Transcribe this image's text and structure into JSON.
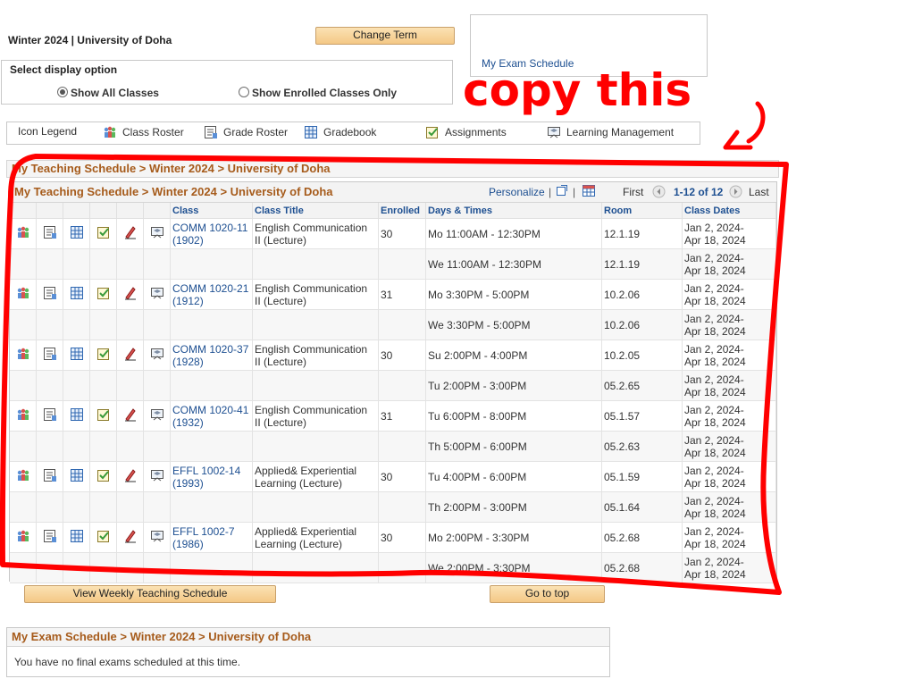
{
  "term_label": "Winter 2024 | University of Doha",
  "change_term_label": "Change Term",
  "exam_schedule_link": "My Exam Schedule",
  "display_option": {
    "title": "Select display option",
    "show_all": "Show All Classes",
    "show_enrolled": "Show Enrolled Classes Only",
    "selected": "show_all"
  },
  "legend": {
    "title": "Icon Legend",
    "items": [
      "Class Roster",
      "Grade Roster",
      "Gradebook",
      "Assignments",
      "Learning Management"
    ]
  },
  "outer_header": "My Teaching Schedule > Winter 2024 > University of Doha",
  "grid": {
    "title": "My Teaching Schedule > Winter 2024 > University of Doha",
    "personalize": "Personalize",
    "separator": "|",
    "first": "First",
    "range": "1-12 of 12",
    "last": "Last",
    "columns": [
      "Class",
      "Class Title",
      "Enrolled",
      "Days & Times",
      "Room",
      "Class Dates"
    ],
    "rows": [
      {
        "icons": true,
        "class_code": "COMM 1020-11",
        "class_num": "(1902)",
        "title1": "English Communication",
        "title2": "II (Lecture)",
        "enrolled": "30",
        "days": "Mo 11:00AM - 12:30PM",
        "room": "12.1.19",
        "date1": "Jan 2, 2024-",
        "date2": "Apr 18, 2024"
      },
      {
        "icons": false,
        "class_code": "",
        "class_num": "",
        "title1": "",
        "title2": "",
        "enrolled": "",
        "days": "We 11:00AM - 12:30PM",
        "room": "12.1.19",
        "date1": "Jan 2, 2024-",
        "date2": "Apr 18, 2024"
      },
      {
        "icons": true,
        "class_code": "COMM 1020-21",
        "class_num": "(1912)",
        "title1": "English Communication",
        "title2": "II (Lecture)",
        "enrolled": "31",
        "days": "Mo 3:30PM - 5:00PM",
        "room": "10.2.06",
        "date1": "Jan 2, 2024-",
        "date2": "Apr 18, 2024"
      },
      {
        "icons": false,
        "class_code": "",
        "class_num": "",
        "title1": "",
        "title2": "",
        "enrolled": "",
        "days": "We 3:30PM - 5:00PM",
        "room": "10.2.06",
        "date1": "Jan 2, 2024-",
        "date2": "Apr 18, 2024"
      },
      {
        "icons": true,
        "class_code": "COMM 1020-37",
        "class_num": "(1928)",
        "title1": "English Communication",
        "title2": "II (Lecture)",
        "enrolled": "30",
        "days": "Su 2:00PM - 4:00PM",
        "room": "10.2.05",
        "date1": "Jan 2, 2024-",
        "date2": "Apr 18, 2024"
      },
      {
        "icons": false,
        "class_code": "",
        "class_num": "",
        "title1": "",
        "title2": "",
        "enrolled": "",
        "days": "Tu 2:00PM - 3:00PM",
        "room": "05.2.65",
        "date1": "Jan 2, 2024-",
        "date2": "Apr 18, 2024"
      },
      {
        "icons": true,
        "class_code": "COMM 1020-41",
        "class_num": "(1932)",
        "title1": "English Communication",
        "title2": "II (Lecture)",
        "enrolled": "31",
        "days": "Tu 6:00PM - 8:00PM",
        "room": "05.1.57",
        "date1": "Jan 2, 2024-",
        "date2": "Apr 18, 2024"
      },
      {
        "icons": false,
        "class_code": "",
        "class_num": "",
        "title1": "",
        "title2": "",
        "enrolled": "",
        "days": "Th 5:00PM - 6:00PM",
        "room": "05.2.63",
        "date1": "Jan 2, 2024-",
        "date2": "Apr 18, 2024"
      },
      {
        "icons": true,
        "class_code": "EFFL 1002-14",
        "class_num": "(1993)",
        "title1": "Applied& Experiential",
        "title2": "Learning (Lecture)",
        "enrolled": "30",
        "days": "Tu 4:00PM - 6:00PM",
        "room": "05.1.59",
        "date1": "Jan 2, 2024-",
        "date2": "Apr 18, 2024"
      },
      {
        "icons": false,
        "class_code": "",
        "class_num": "",
        "title1": "",
        "title2": "",
        "enrolled": "",
        "days": "Th 2:00PM - 3:00PM",
        "room": "05.1.64",
        "date1": "Jan 2, 2024-",
        "date2": "Apr 18, 2024"
      },
      {
        "icons": true,
        "class_code": "EFFL 1002-7",
        "class_num": "(1986)",
        "title1": "Applied& Experiential",
        "title2": "Learning (Lecture)",
        "enrolled": "30",
        "days": "Mo 2:00PM - 3:30PM",
        "room": "05.2.68",
        "date1": "Jan 2, 2024-",
        "date2": "Apr 18, 2024"
      },
      {
        "icons": false,
        "class_code": "",
        "class_num": "",
        "title1": "",
        "title2": "",
        "enrolled": "",
        "days": "We 2:00PM - 3:30PM",
        "room": "05.2.68",
        "date1": "Jan 2, 2024-",
        "date2": "Apr 18, 2024"
      }
    ]
  },
  "weekly_button": "View Weekly Teaching Schedule",
  "go_to_top": "Go to top",
  "exam_panel": {
    "title": "My Exam Schedule > Winter 2024 > University of Doha",
    "message": "You have no final exams scheduled at this time."
  },
  "annotation_text": "copy this",
  "colors": {
    "header_text": "#a65b1b",
    "link": "#1d4f91",
    "annotation": "#ff0000",
    "button": "#f4c885"
  }
}
